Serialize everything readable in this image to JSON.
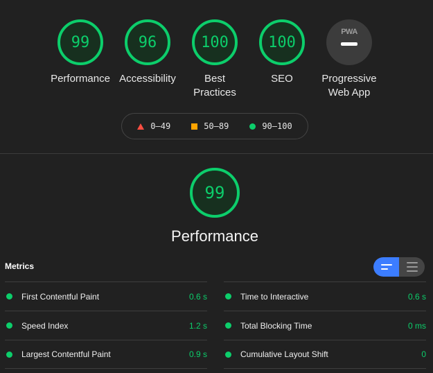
{
  "categories": [
    {
      "score": "99",
      "label": "Performance"
    },
    {
      "score": "96",
      "label": "Accessibility"
    },
    {
      "score": "100",
      "label": "Best Practices"
    },
    {
      "score": "100",
      "label": "SEO"
    }
  ],
  "pwa": {
    "badge_text": "PWA",
    "label": "Progressive Web App"
  },
  "legend": {
    "fail": "0–49",
    "average": "50–89",
    "pass": "90–100"
  },
  "colors": {
    "pass": "#0cce6b",
    "average": "#ffa400",
    "fail": "#ff4e42",
    "accent": "#3c7dff"
  },
  "performance": {
    "score": "99",
    "title": "Performance"
  },
  "metrics": {
    "heading": "Metrics",
    "left": [
      {
        "name": "First Contentful Paint",
        "value": "0.6 s"
      },
      {
        "name": "Speed Index",
        "value": "1.2 s"
      },
      {
        "name": "Largest Contentful Paint",
        "value": "0.9 s"
      }
    ],
    "right": [
      {
        "name": "Time to Interactive",
        "value": "0.6 s"
      },
      {
        "name": "Total Blocking Time",
        "value": "0 ms"
      },
      {
        "name": "Cumulative Layout Shift",
        "value": "0"
      }
    ]
  }
}
